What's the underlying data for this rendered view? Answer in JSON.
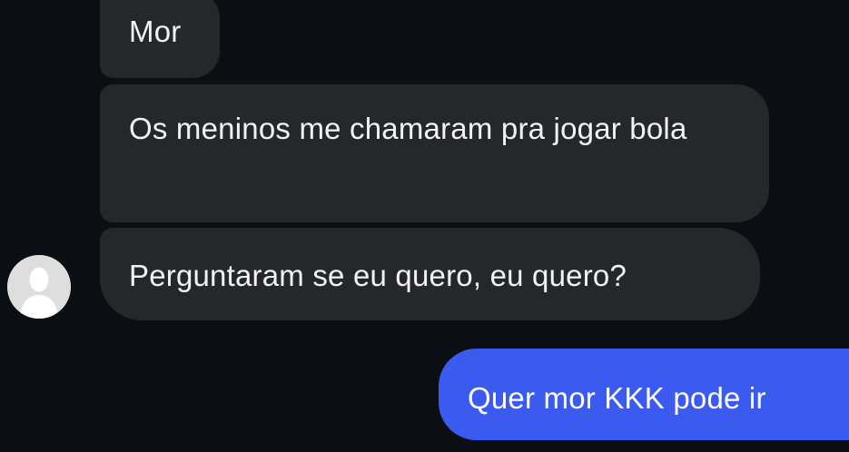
{
  "messages": [
    {
      "direction": "incoming",
      "text": "Mor"
    },
    {
      "direction": "incoming",
      "text": "Os meninos me chamaram pra jogar bola"
    },
    {
      "direction": "incoming",
      "text": "Perguntaram se eu quero, eu quero?"
    },
    {
      "direction": "outgoing",
      "text": "Quer mor KKK pode ir"
    }
  ],
  "contact": {
    "avatar_icon": "default-user-avatar-icon"
  },
  "colors": {
    "background": "#0b0f13",
    "incoming_bubble": "#25272b",
    "outgoing_bubble": "#3b5bf0",
    "text": "#f2f2f2",
    "avatar": "#dedede"
  }
}
